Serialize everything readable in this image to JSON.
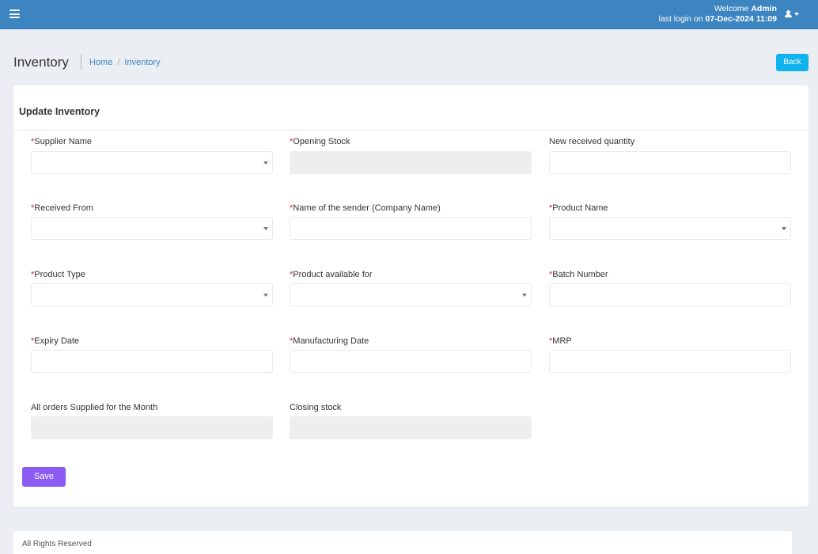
{
  "topbar": {
    "welcome_prefix": "Welcome",
    "username": "Admin",
    "last_login_prefix": "last login on",
    "last_login_time": "07-Dec-2024 11:09",
    "icons": {
      "menu": "hamburger-menu-icon",
      "user": "user-icon",
      "caret": "caret-down-icon"
    }
  },
  "header": {
    "title": "Inventory",
    "breadcrumb": [
      "Home",
      "Inventory"
    ],
    "back_label": "Back"
  },
  "form": {
    "title": "Update Inventory",
    "required_marker": "*",
    "fields": [
      {
        "label": "Supplier Name",
        "required": true,
        "type": "select",
        "value": ""
      },
      {
        "label": "Opening Stock",
        "required": true,
        "type": "text",
        "disabled": true,
        "value": ""
      },
      {
        "label": "New received quantity",
        "required": false,
        "type": "text",
        "value": ""
      },
      {
        "label": "Received From",
        "required": true,
        "type": "select",
        "value": ""
      },
      {
        "label": "Name of the sender (Company Name)",
        "required": true,
        "type": "text",
        "value": ""
      },
      {
        "label": "Product Name",
        "required": true,
        "type": "select",
        "value": ""
      },
      {
        "label": "Product Type",
        "required": true,
        "type": "select",
        "value": ""
      },
      {
        "label": "Product available for",
        "required": true,
        "type": "select",
        "value": ""
      },
      {
        "label": "Batch Number",
        "required": true,
        "type": "text",
        "value": ""
      },
      {
        "label": "Expiry Date",
        "required": true,
        "type": "text",
        "value": ""
      },
      {
        "label": "Manufacturing Date",
        "required": true,
        "type": "text",
        "value": ""
      },
      {
        "label": "MRP",
        "required": true,
        "type": "text",
        "value": ""
      },
      {
        "label": "All orders Supplied for the Month",
        "required": false,
        "type": "text",
        "disabled": true,
        "value": ""
      },
      {
        "label": "Closing stock",
        "required": false,
        "type": "text",
        "disabled": true,
        "value": ""
      }
    ],
    "save_label": "Save"
  },
  "footer": {
    "text": "All Rights Reserved"
  },
  "colors": {
    "topbar": "#3d85c1",
    "back_button": "#11b3ef",
    "save_button": "#8c5cf5",
    "required": "#d9232e",
    "page_background": "#ebeef3"
  }
}
